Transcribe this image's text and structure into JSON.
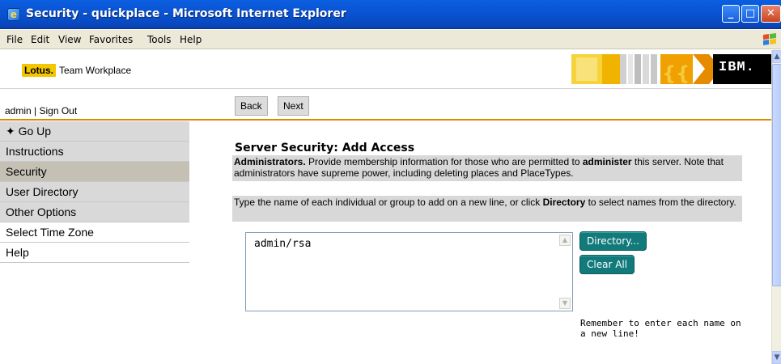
{
  "window": {
    "title": "Security - quickplace - Microsoft Internet Explorer",
    "min_glyph": "_",
    "max_glyph": "□",
    "close_glyph": "✕"
  },
  "menu": [
    "File",
    "Edit",
    "View",
    "Favorites",
    "Tools",
    "Help"
  ],
  "brand": {
    "logo_text": "Lotus.",
    "product_name": "Team Workplace",
    "ibm_logo": "IBM."
  },
  "user": {
    "line": "admin  |  Sign Out"
  },
  "toolbar": {
    "back_label": "Back",
    "next_label": "Next"
  },
  "sidebar": {
    "items": [
      {
        "label": "✦ Go Up"
      },
      {
        "label": "Instructions"
      },
      {
        "label": "Security"
      },
      {
        "label": "User Directory"
      },
      {
        "label": "Other Options"
      },
      {
        "label": "Select Time Zone"
      },
      {
        "label": "Help"
      }
    ]
  },
  "main": {
    "heading": "Server Security: Add Access",
    "admin_bold": "Administrators.",
    "admin_text_1": " Provide membership information for those who are permitted to ",
    "admin_bold_2": "administer",
    "admin_text_2": " this server. Note that administrators have supreme power, including deleting places and PlaceTypes.",
    "type_text_1": "Type the name of each individual or group to add on a new line, or click ",
    "type_bold": "Directory",
    "type_text_2": " to select names from the directory.",
    "names_value": "admin/rsa",
    "directory_label": "Directory...",
    "clear_label": "Clear All",
    "reminder": "Remember to enter each name on a new line!"
  },
  "colors": {
    "titlebar": "#0a54d4",
    "accent_orange": "#d98c00",
    "teal_button": "#127a7a",
    "lotus_yellow": "#f3c600"
  }
}
